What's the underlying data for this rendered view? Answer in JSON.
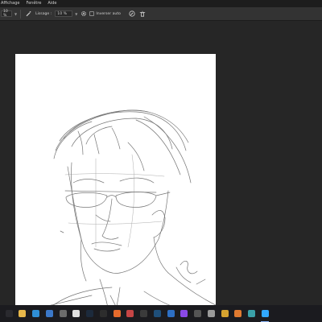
{
  "menubar": {
    "items": [
      "Affichage",
      "Fenêtre",
      "Aide"
    ]
  },
  "options_bar": {
    "size_value": "10 %",
    "smoothing_label": "Lissage :",
    "smoothing_value": "10 %",
    "auto_erase_label": "Inverser auto"
  },
  "canvas": {
    "artwork": "pencil portrait sketch"
  },
  "taskbar": {
    "apps": [
      {
        "icon": "windows-start-icon",
        "color": "#2a2a2f"
      },
      {
        "icon": "file-explorer-icon",
        "color": "#e8b84a"
      },
      {
        "icon": "edge-browser-icon",
        "color": "#2f8fd6"
      },
      {
        "icon": "mail-icon",
        "color": "#3b78c9"
      },
      {
        "icon": "store-icon",
        "color": "#6b6b6b"
      },
      {
        "icon": "photos-icon",
        "color": "#e0e0e0"
      },
      {
        "icon": "steam-icon",
        "color": "#1c2a3c"
      },
      {
        "icon": "app-dark-icon",
        "color": "#2d2d2d"
      },
      {
        "icon": "firefox-icon",
        "color": "#e66b2c"
      },
      {
        "icon": "app-red-icon",
        "color": "#c64545"
      },
      {
        "icon": "sound-icon",
        "color": "#3b3b3b"
      },
      {
        "icon": "terminal-icon",
        "color": "#1f4f7a"
      },
      {
        "icon": "app-blue-icon",
        "color": "#2d6fc4"
      },
      {
        "icon": "twitch-icon",
        "color": "#8a49e6"
      },
      {
        "icon": "app-grey-icon",
        "color": "#555555"
      },
      {
        "icon": "clock-icon",
        "color": "#9a9a9a"
      },
      {
        "icon": "chrome-icon",
        "color": "#d6a330"
      },
      {
        "icon": "app-orange-icon",
        "color": "#e07a30"
      },
      {
        "icon": "app-teal-icon",
        "color": "#3aa0a8"
      },
      {
        "icon": "photoshop-icon",
        "color": "#31a8ff"
      }
    ]
  }
}
